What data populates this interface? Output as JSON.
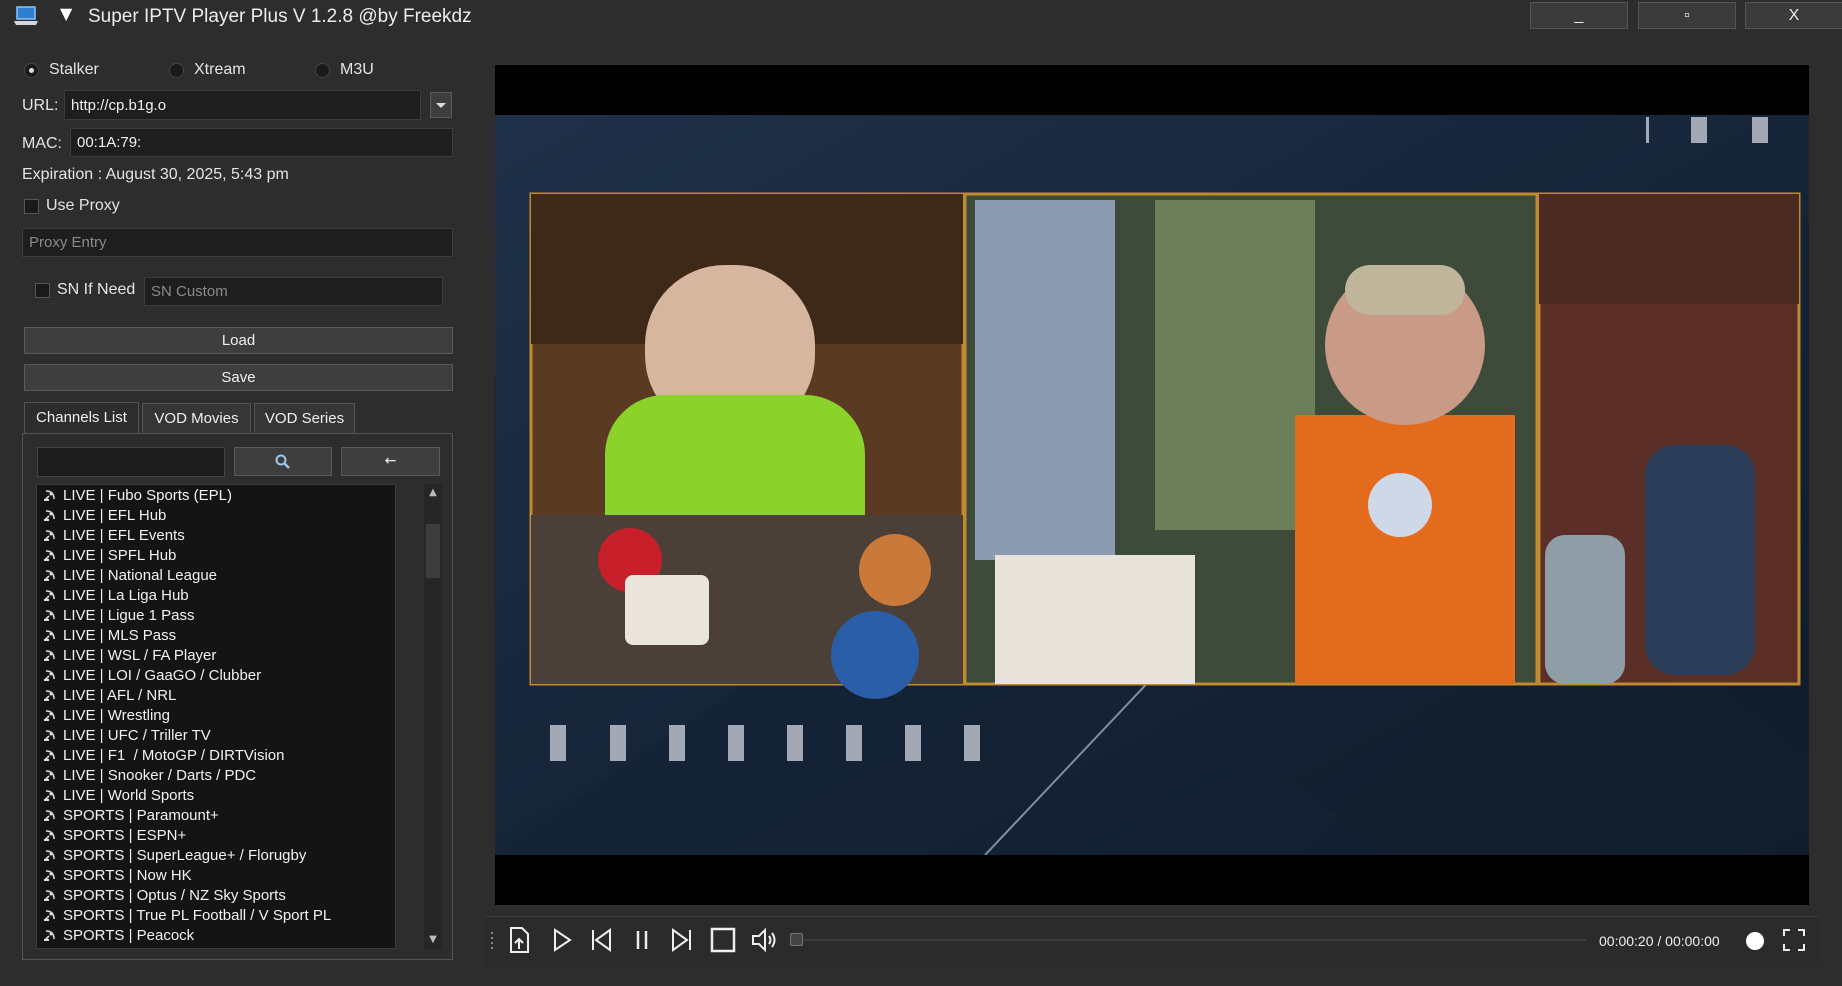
{
  "window": {
    "title": "Super IPTV Player Plus V 1.2.8 @by Freekdz",
    "menu_arrow": "▼",
    "minimize": "_",
    "maximize": "▫",
    "close": "X"
  },
  "source": {
    "options": [
      "Stalker",
      "Xtream",
      "M3U"
    ],
    "selected": "Stalker"
  },
  "url": {
    "label": "URL:",
    "value": "http://cp.b1g.o"
  },
  "mac": {
    "label": "MAC:",
    "value": "00:1A:79:"
  },
  "expiration": "Expiration : August 30, 2025, 5:43 pm",
  "proxy": {
    "label": "Use Proxy",
    "placeholder": "Proxy Entry",
    "checked": false
  },
  "sn": {
    "label": "SN If Need",
    "placeholder": "SN Custom",
    "checked": false
  },
  "buttons": {
    "load": "Load",
    "save": "Save"
  },
  "tabs": [
    "Channels List",
    "VOD Movies",
    "VOD Series"
  ],
  "search": {
    "value": "",
    "search_icon": "magnifier-icon",
    "back_label": "←"
  },
  "channels": [
    "LIVE | Fubo Sports (EPL)",
    "LIVE | EFL Hub",
    "LIVE | EFL Events",
    "LIVE | SPFL Hub",
    "LIVE | National League",
    "LIVE | La Liga Hub",
    "LIVE | Ligue 1 Pass",
    "LIVE | MLS Pass",
    "LIVE | WSL / FA Player",
    "LIVE | LOI / GaaGO / Clubber",
    "LIVE | AFL / NRL",
    "LIVE | Wrestling",
    "LIVE | UFC / Triller TV",
    "LIVE | F1  / MotoGP / DIRTVision",
    "LIVE | Snooker / Darts / PDC",
    "LIVE | World Sports",
    "SPORTS | Paramount+",
    "SPORTS | ESPN+",
    "SPORTS | SuperLeague+ / Florugby",
    "SPORTS | Now HK",
    "SPORTS | Optus / NZ Sky Sports",
    "SPORTS | True PL Football / V Sport PL",
    "SPORTS | Peacock"
  ],
  "player": {
    "time": "00:00:20 / 00:00:00",
    "progress": 0
  },
  "colors": {
    "background": "#2d2d2d",
    "list_bg": "#141414",
    "frame_border": "#c08a2f",
    "video_bg": "#162437"
  }
}
